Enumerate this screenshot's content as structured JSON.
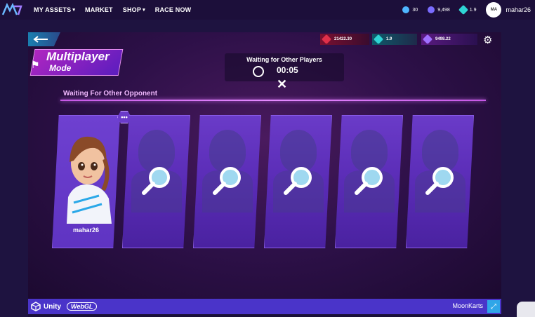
{
  "nav": {
    "items": [
      {
        "label": "MY ASSETS",
        "caret": true
      },
      {
        "label": "MARKET",
        "caret": false
      },
      {
        "label": "SHOP",
        "caret": true
      },
      {
        "label": "RACE NOW",
        "caret": false
      }
    ],
    "stats": [
      {
        "value": "30",
        "color": "#4fb6ff"
      },
      {
        "value": "9,498",
        "color": "#7a6cff"
      },
      {
        "value": "1.9",
        "color": "#2fd4d4"
      }
    ],
    "avatar_initials": "MA",
    "username": "mahar26"
  },
  "game": {
    "title_line1": "Multiplayer",
    "title_line2": "Mode",
    "waiting_title": "Waiting for Other Players",
    "timer": "00:05",
    "close_symbol": "✕",
    "resources": [
      {
        "value": "21422.30",
        "color": "#e0304a"
      },
      {
        "value": "1.9",
        "color": "#2fd4d4"
      },
      {
        "value": "9498.22",
        "color": "#a070ff"
      }
    ],
    "subtitle": "Waiting For Other Opponent",
    "chat_symbol": "•••",
    "player_card": {
      "name": "mahar26"
    },
    "empty_slots": 5
  },
  "footer": {
    "unity": "Unity",
    "webgl": "WebGL",
    "product": "MoonKarts"
  }
}
